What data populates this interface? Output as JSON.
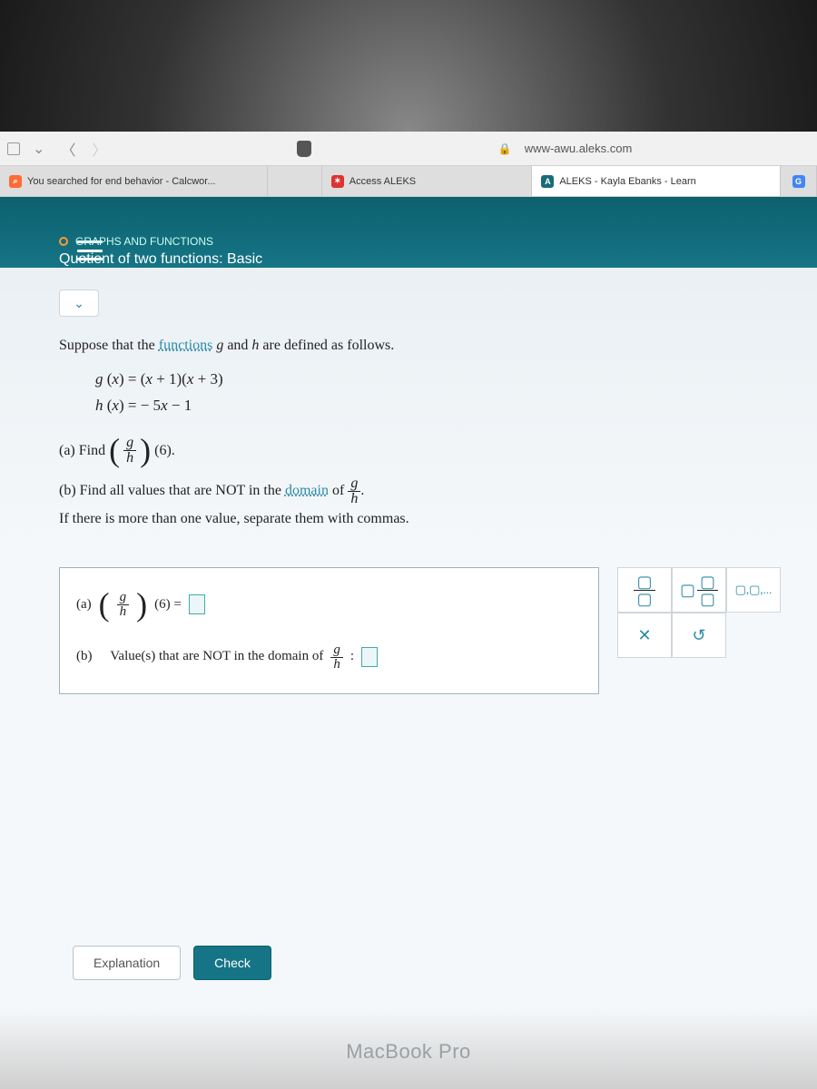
{
  "addressbar": {
    "url": "www-awu.aleks.com"
  },
  "tabs": {
    "t1": "You searched for end behavior - Calcwor...",
    "t2": "Access ALEKS",
    "t3": "ALEKS - Kayla Ebanks - Learn"
  },
  "header": {
    "category": "GRAPHS AND FUNCTIONS",
    "title": "Quotient of two functions: Basic"
  },
  "problem": {
    "intro_1": "Suppose that the ",
    "intro_link": "functions",
    "intro_2": " g and h are defined as follows.",
    "g_def": "g (x) = (x + 1)(x + 3)",
    "h_def": "h (x) = − 5x − 1",
    "a_label": "(a) Find",
    "a_tail": "(6).",
    "b_1": "(b) Find all values that are NOT in the ",
    "b_link": "domain",
    "b_2": " of ",
    "b_tail": ".",
    "if_line": "If there is more than one value, separate them with commas."
  },
  "answers": {
    "a_label": "(a)",
    "a_eq_tail": "(6) = ",
    "b_prefix": "(b)",
    "b_text_1": "Value(s) that are NOT in the domain of ",
    "b_colon": " : "
  },
  "tools": {
    "list_hint": "▢,▢,..."
  },
  "buttons": {
    "explanation": "Explanation",
    "check": "Check"
  },
  "device": "MacBook Pro"
}
